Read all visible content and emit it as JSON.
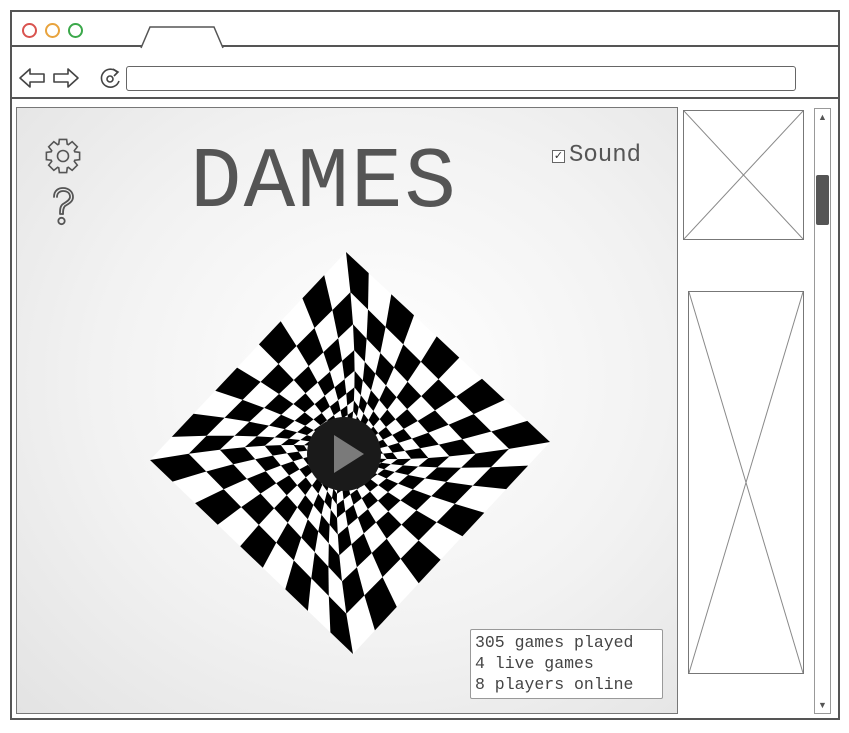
{
  "window": {
    "controls": [
      "close",
      "minimize",
      "maximize"
    ],
    "colors": {
      "close": "#d9534f",
      "minimize": "#e8a33d",
      "maximize": "#3ba84a"
    }
  },
  "toolbar": {
    "back_icon": "arrow-left-icon",
    "forward_icon": "arrow-right-icon",
    "reload_icon": "reload-icon",
    "address_value": ""
  },
  "game": {
    "title": "DAMES",
    "sound": {
      "label": "Sound",
      "checked": true
    },
    "icons": [
      "gear-icon",
      "help-icon"
    ],
    "play_icon": "play-icon",
    "stats": {
      "games_played": "305 games played",
      "live_games": "4 live games",
      "players_online": "8 players online"
    }
  },
  "colors": {
    "board_dark": "#000000",
    "board_light": "#ffffff",
    "text": "#555555"
  }
}
